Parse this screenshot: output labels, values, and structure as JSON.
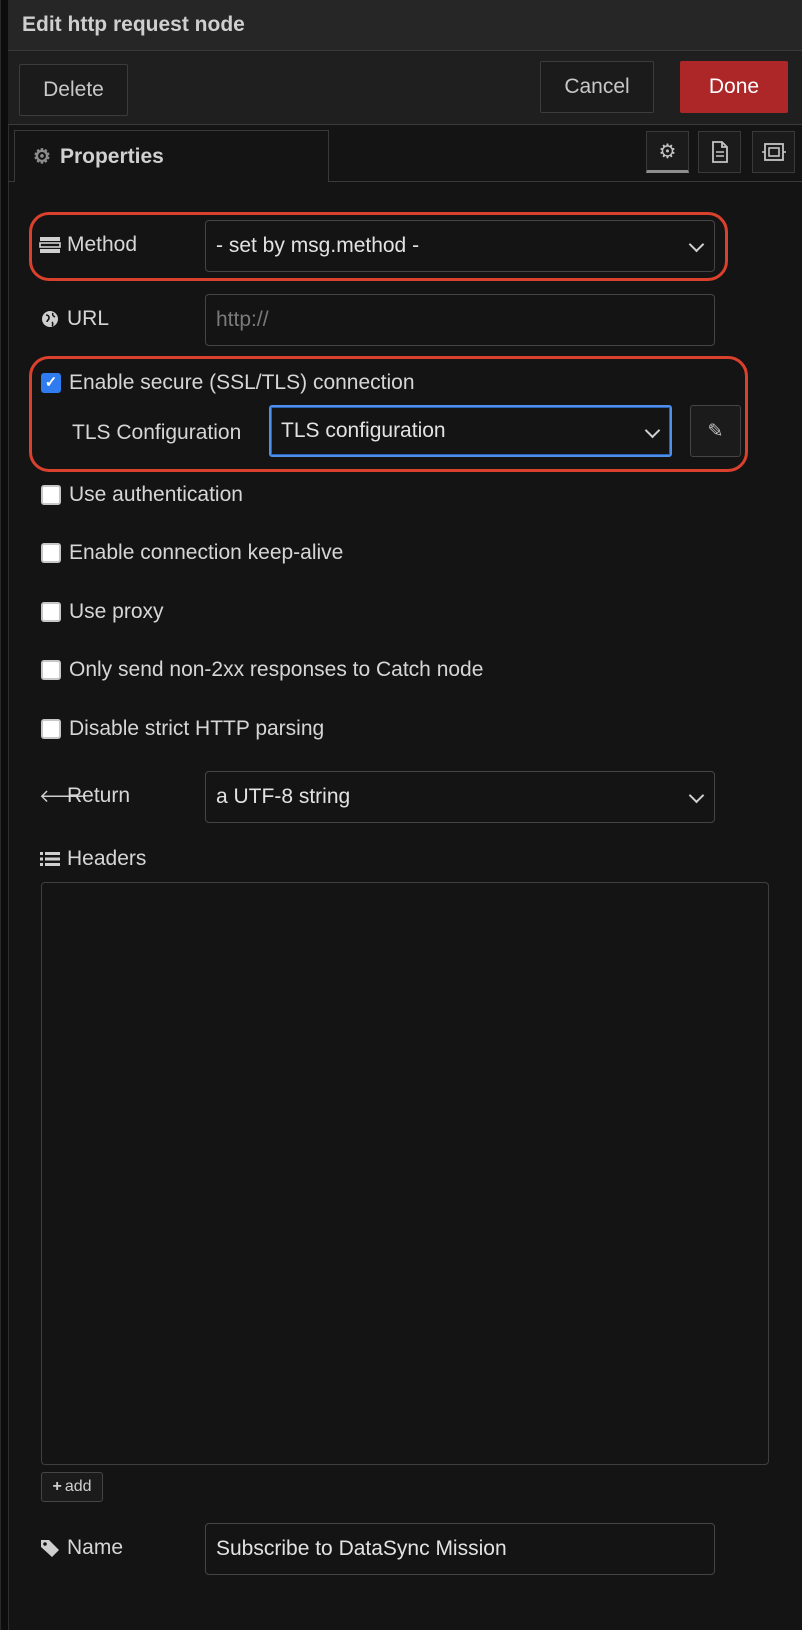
{
  "header": {
    "title": "Edit http request node"
  },
  "toolbar": {
    "delete_label": "Delete",
    "cancel_label": "Cancel",
    "done_label": "Done"
  },
  "tabs": {
    "properties_label": "Properties",
    "icons": [
      "gear-icon",
      "document-icon",
      "frame-icon"
    ]
  },
  "form": {
    "method": {
      "label": "Method",
      "value": "- set by msg.method -"
    },
    "url": {
      "label": "URL",
      "placeholder": "http://"
    },
    "tls": {
      "enable_label": "Enable secure (SSL/TLS) connection",
      "enabled": true,
      "config_label": "TLS Configuration",
      "config_value": "TLS configuration"
    },
    "options": [
      {
        "label": "Use authentication",
        "checked": false
      },
      {
        "label": "Enable connection keep-alive",
        "checked": false
      },
      {
        "label": "Use proxy",
        "checked": false
      },
      {
        "label": "Only send non-2xx responses to Catch node",
        "checked": false
      },
      {
        "label": "Disable strict HTTP parsing",
        "checked": false
      }
    ],
    "return": {
      "label": "Return",
      "value": "a UTF-8 string"
    },
    "headers": {
      "label": "Headers",
      "add_label": "add"
    },
    "name": {
      "label": "Name",
      "value": "Subscribe to DataSync Mission"
    }
  },
  "colors": {
    "done": "#ad2729",
    "highlight": "#d9412d",
    "focus": "#4f8fe8",
    "checkbox": "#2f7cf0"
  }
}
